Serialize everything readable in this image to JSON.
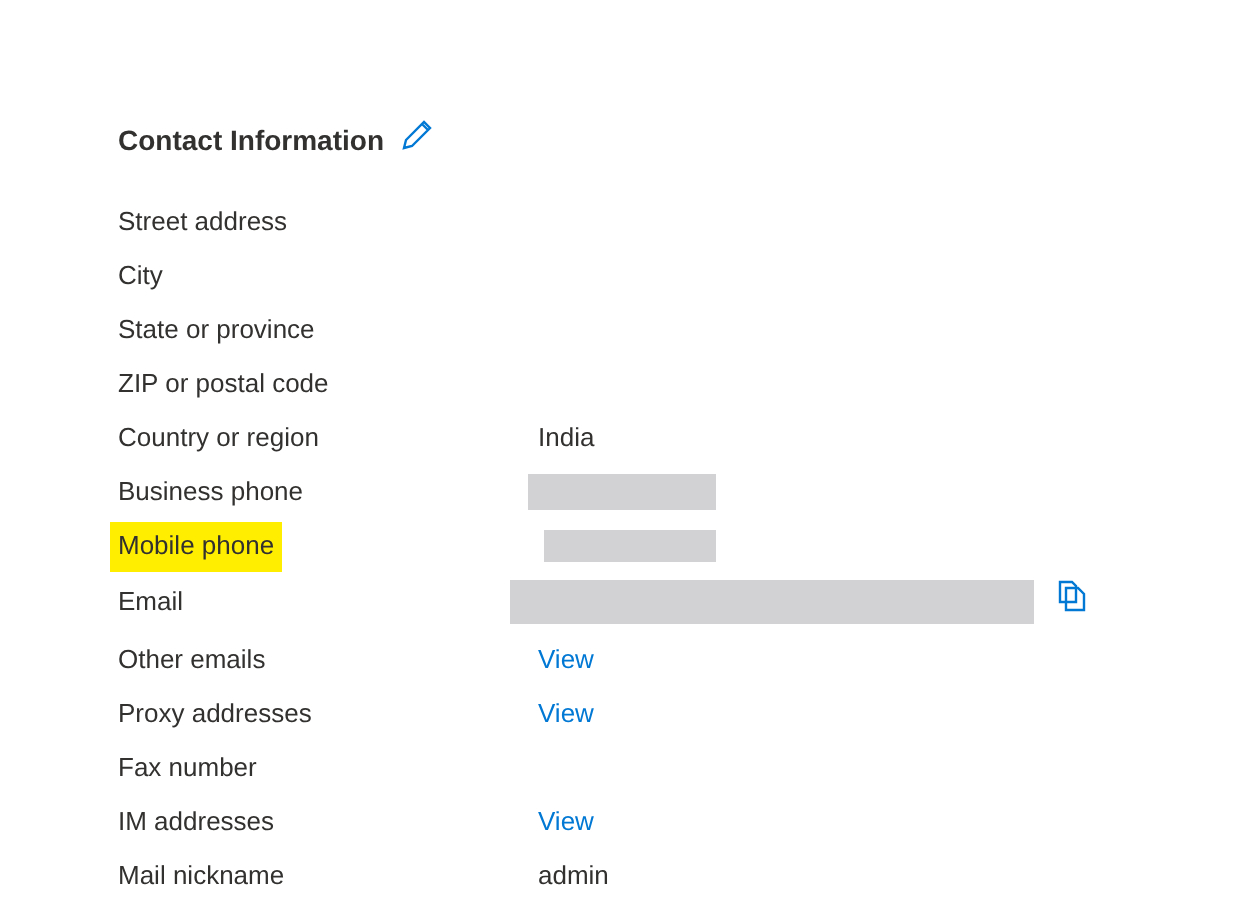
{
  "section": {
    "title": "Contact Information"
  },
  "fields": [
    {
      "label": "Street address",
      "kind": "empty",
      "highlighted": false
    },
    {
      "label": "City",
      "kind": "empty",
      "highlighted": false
    },
    {
      "label": "State or province",
      "kind": "empty",
      "highlighted": false
    },
    {
      "label": "ZIP or postal code",
      "kind": "empty",
      "highlighted": false
    },
    {
      "label": "Country or region",
      "kind": "text",
      "value": "India",
      "highlighted": false
    },
    {
      "label": "Business phone",
      "kind": "redacted",
      "highlighted": false
    },
    {
      "label": "Mobile phone",
      "kind": "redacted",
      "highlighted": true
    },
    {
      "label": "Email",
      "kind": "redacted_copy",
      "highlighted": false
    },
    {
      "label": "Other emails",
      "kind": "link",
      "value": "View",
      "highlighted": false
    },
    {
      "label": "Proxy addresses",
      "kind": "link",
      "value": "View",
      "highlighted": false
    },
    {
      "label": "Fax number",
      "kind": "empty",
      "highlighted": false
    },
    {
      "label": "IM addresses",
      "kind": "link",
      "value": "View",
      "highlighted": false
    },
    {
      "label": "Mail nickname",
      "kind": "text",
      "value": "admin",
      "highlighted": false
    }
  ]
}
